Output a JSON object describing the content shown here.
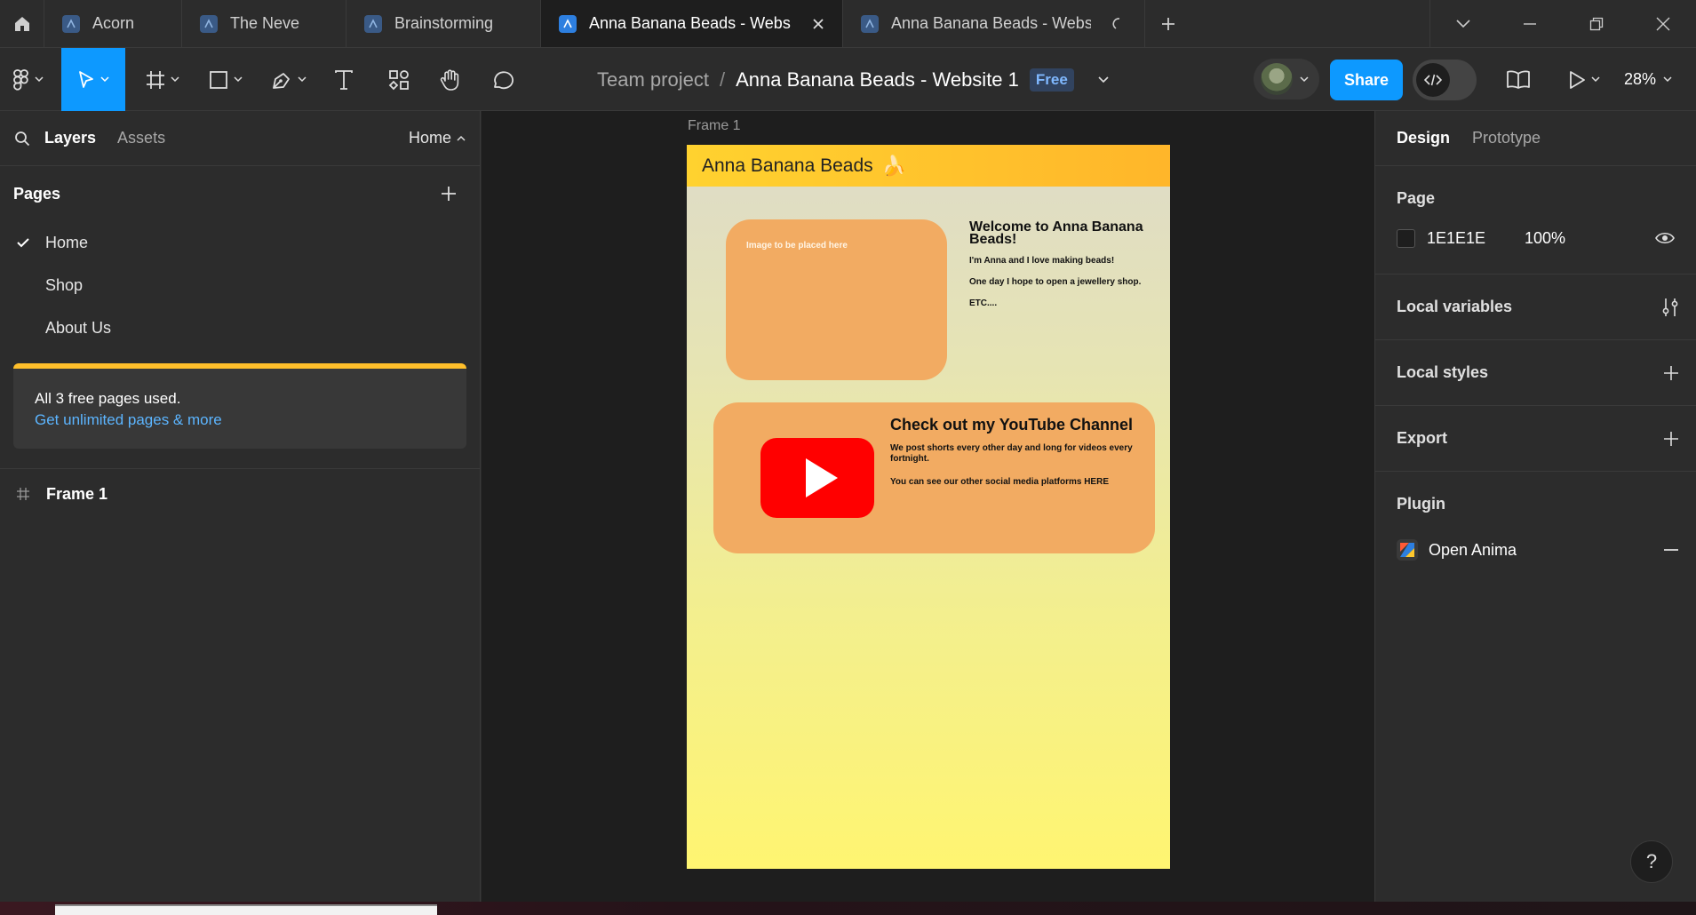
{
  "tabs": [
    {
      "label": "Acorn",
      "active": false
    },
    {
      "label": "The Neve",
      "active": false
    },
    {
      "label": "Brainstorming",
      "active": false
    },
    {
      "label": "Anna Banana Beads - Website",
      "active": true
    },
    {
      "label": "Anna Banana Beads - Website",
      "active": false,
      "loading": true
    }
  ],
  "toolbar": {
    "team": "Team project",
    "separator": "/",
    "file_name": "Anna Banana Beads - Website 1",
    "plan_badge": "Free",
    "share_label": "Share",
    "zoom": "28%"
  },
  "left_panel": {
    "tab_layers": "Layers",
    "tab_assets": "Assets",
    "current_page": "Home",
    "pages_title": "Pages",
    "pages": [
      {
        "label": "Home",
        "selected": true
      },
      {
        "label": "Shop",
        "selected": false
      },
      {
        "label": "About Us",
        "selected": false
      }
    ],
    "upsell_text": "All 3 free pages used.",
    "upsell_link": "Get unlimited pages & more",
    "layers": [
      {
        "label": "Frame 1",
        "icon": "frame-icon"
      }
    ]
  },
  "canvas": {
    "frame_label": "Frame 1",
    "site": {
      "title": "Anna Banana Beads",
      "title_emoji": "🍌",
      "image_placeholder": "Image to be placed here",
      "welcome_heading": "Welcome to Anna Banana Beads!",
      "welcome_lines": [
        "I'm Anna and I love making beads!",
        "One day I hope to open a jewellery shop.",
        "ETC...."
      ],
      "yt_heading": "Check out my YouTube Channel",
      "yt_line1": "We post shorts every other day and long for videos every fortnight.",
      "yt_line2": "You can see our other social media platforms HERE"
    }
  },
  "right_panel": {
    "tab_design": "Design",
    "tab_prototype": "Prototype",
    "page_section": "Page",
    "page_color": "1E1E1E",
    "page_opacity": "100%",
    "local_variables": "Local variables",
    "local_styles": "Local styles",
    "export": "Export",
    "plugin_section": "Plugin",
    "plugin_name": "Open Anima"
  },
  "help_label": "?",
  "colors": {
    "accent": "#0d99ff",
    "upsell_bar": "#ffbf2b",
    "card": "#f2ab62",
    "youtube_red": "#ff0000"
  }
}
